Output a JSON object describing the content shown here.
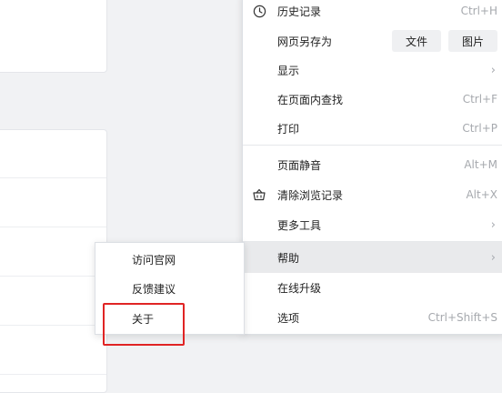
{
  "menu": {
    "history": {
      "label": "历史记录",
      "shortcut": "Ctrl+H"
    },
    "save_as": {
      "label": "网页另存为",
      "file_button": "文件",
      "image_button": "图片"
    },
    "display": {
      "label": "显示"
    },
    "find": {
      "label": "在页面内查找",
      "shortcut": "Ctrl+F"
    },
    "print": {
      "label": "打印",
      "shortcut": "Ctrl+P"
    },
    "mute": {
      "label": "页面静音",
      "shortcut": "Alt+M"
    },
    "clear_data": {
      "label": "清除浏览记录",
      "shortcut": "Alt+X"
    },
    "more_tools": {
      "label": "更多工具"
    },
    "help": {
      "label": "帮助"
    },
    "upgrade": {
      "label": "在线升级"
    },
    "options": {
      "label": "选项",
      "shortcut": "Ctrl+Shift+S"
    }
  },
  "submenu": {
    "visit_site": "访问官网",
    "feedback": "反馈建议",
    "about": "关于"
  },
  "icons": {
    "history": "clock-icon",
    "clear_data": "basket-icon",
    "chevron": "chevron-right-icon"
  },
  "colors": {
    "highlight_border": "#e02424",
    "active_row": "#e9eaec"
  }
}
